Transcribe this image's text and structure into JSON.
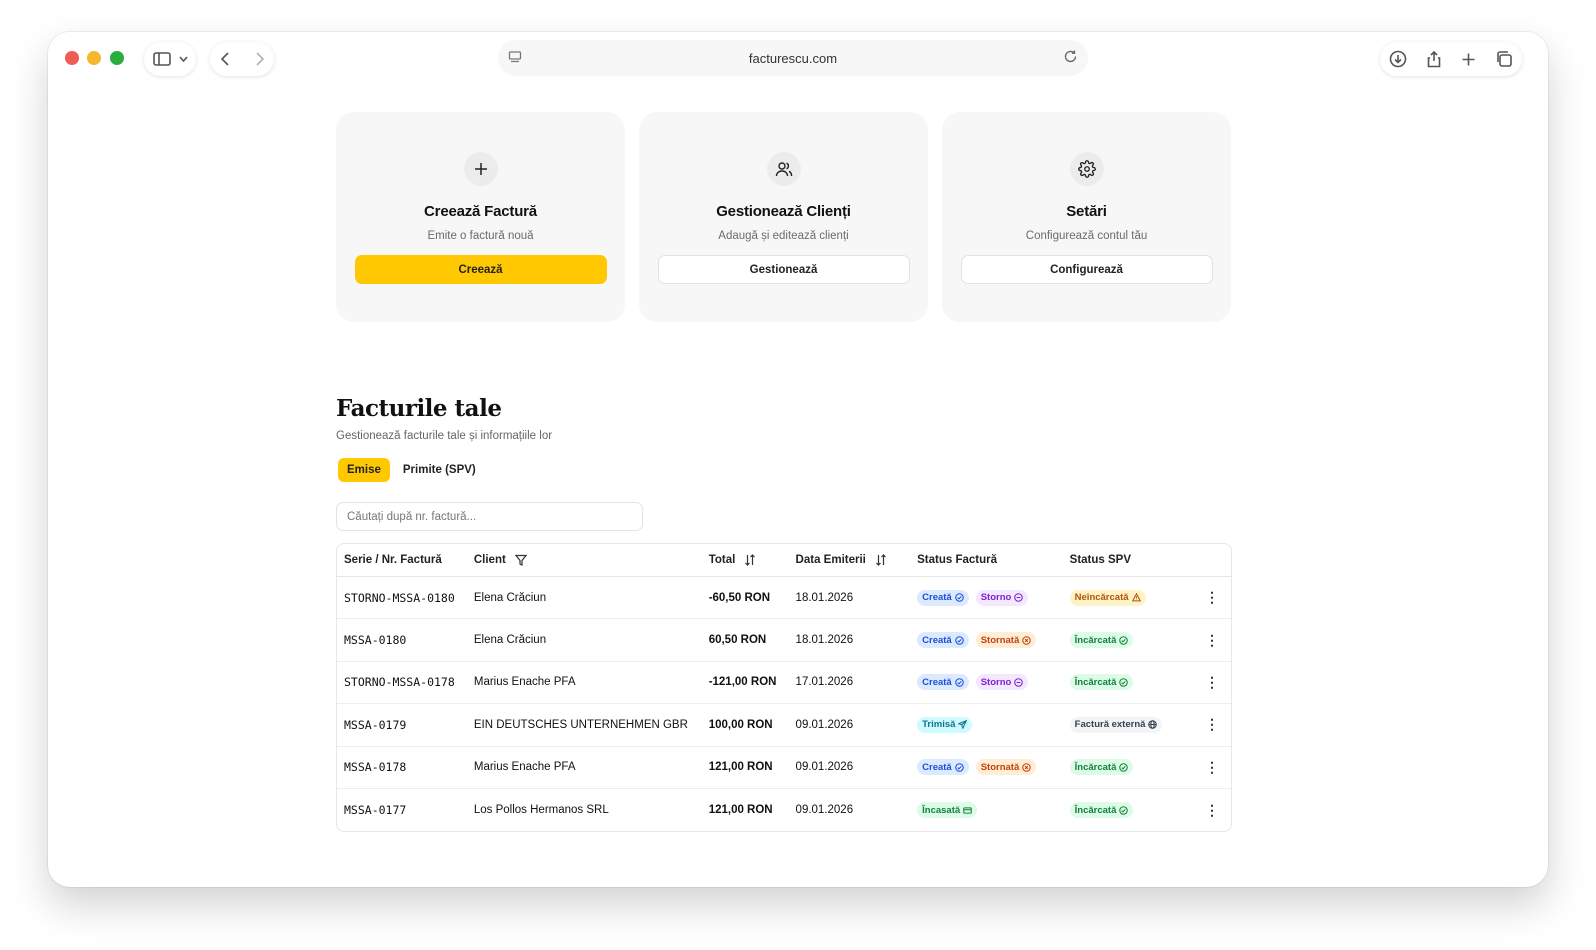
{
  "browser": {
    "url": "facturescu.com"
  },
  "cards": [
    {
      "icon": "plus-icon",
      "title": "Creează Factură",
      "subtitle": "Emite o factură nouă",
      "button": "Creează"
    },
    {
      "icon": "users-icon",
      "title": "Gestionează Clienți",
      "subtitle": "Adaugă și editează clienți",
      "button": "Gestionează"
    },
    {
      "icon": "gear-icon",
      "title": "Setări",
      "subtitle": "Configurează contul tău",
      "button": "Configurează"
    }
  ],
  "section": {
    "title": "Facturile tale",
    "subtitle": "Gestionează facturile tale și informațiile lor"
  },
  "tabs": [
    {
      "label": "Emise",
      "active": true
    },
    {
      "label": "Primite (SPV)",
      "active": false
    }
  ],
  "search": {
    "placeholder": "Căutați după nr. factură..."
  },
  "table": {
    "headers": {
      "series": "Serie / Nr. Factură",
      "client": "Client",
      "total": "Total",
      "date": "Data Emiterii",
      "status": "Status Factură",
      "spv": "Status SPV"
    },
    "rows": [
      {
        "series": "STORNO-MSSA-0180",
        "client": "Elena Crăciun",
        "total": "-60,50 RON",
        "date": "18.01.2026",
        "status": [
          {
            "label": "Creată",
            "color": "blue",
            "icon": "check-circle-icon"
          },
          {
            "label": "Storno",
            "color": "purple",
            "icon": "minus-circle-icon"
          }
        ],
        "spv": {
          "label": "Neîncărcată",
          "color": "amber",
          "icon": "warning-icon"
        }
      },
      {
        "series": "MSSA-0180",
        "client": "Elena Crăciun",
        "total": "60,50 RON",
        "date": "18.01.2026",
        "status": [
          {
            "label": "Creată",
            "color": "blue",
            "icon": "check-circle-icon"
          },
          {
            "label": "Stornată",
            "color": "orange",
            "icon": "x-circle-icon"
          }
        ],
        "spv": {
          "label": "Încărcată",
          "color": "green",
          "icon": "check-circle-icon"
        }
      },
      {
        "series": "STORNO-MSSA-0178",
        "client": "Marius Enache PFA",
        "total": "-121,00 RON",
        "date": "17.01.2026",
        "status": [
          {
            "label": "Creată",
            "color": "blue",
            "icon": "check-circle-icon"
          },
          {
            "label": "Storno",
            "color": "purple",
            "icon": "minus-circle-icon"
          }
        ],
        "spv": {
          "label": "Încărcată",
          "color": "green",
          "icon": "check-circle-icon"
        }
      },
      {
        "series": "MSSA-0179",
        "client": "EIN DEUTSCHES UNTERNEHMEN GBR",
        "total": "100,00 RON",
        "date": "09.01.2026",
        "status": [
          {
            "label": "Trimisă",
            "color": "cyan",
            "icon": "send-icon"
          }
        ],
        "spv": {
          "label": "Factură externă",
          "color": "gray",
          "icon": "globe-icon"
        }
      },
      {
        "series": "MSSA-0178",
        "client": "Marius Enache PFA",
        "total": "121,00 RON",
        "date": "09.01.2026",
        "status": [
          {
            "label": "Creată",
            "color": "blue",
            "icon": "check-circle-icon"
          },
          {
            "label": "Stornată",
            "color": "orange",
            "icon": "x-circle-icon"
          }
        ],
        "spv": {
          "label": "Încărcată",
          "color": "green",
          "icon": "check-circle-icon"
        }
      },
      {
        "series": "MSSA-0177",
        "client": "Los Pollos Hermanos SRL",
        "total": "121,00 RON",
        "date": "09.01.2026",
        "status": [
          {
            "label": "Încasată",
            "color": "green",
            "icon": "card-icon"
          }
        ],
        "spv": {
          "label": "Încărcată",
          "color": "green",
          "icon": "check-circle-icon"
        }
      }
    ]
  },
  "colors": {
    "accent": "#ffc800",
    "card_bg": "#f7f7f7"
  }
}
